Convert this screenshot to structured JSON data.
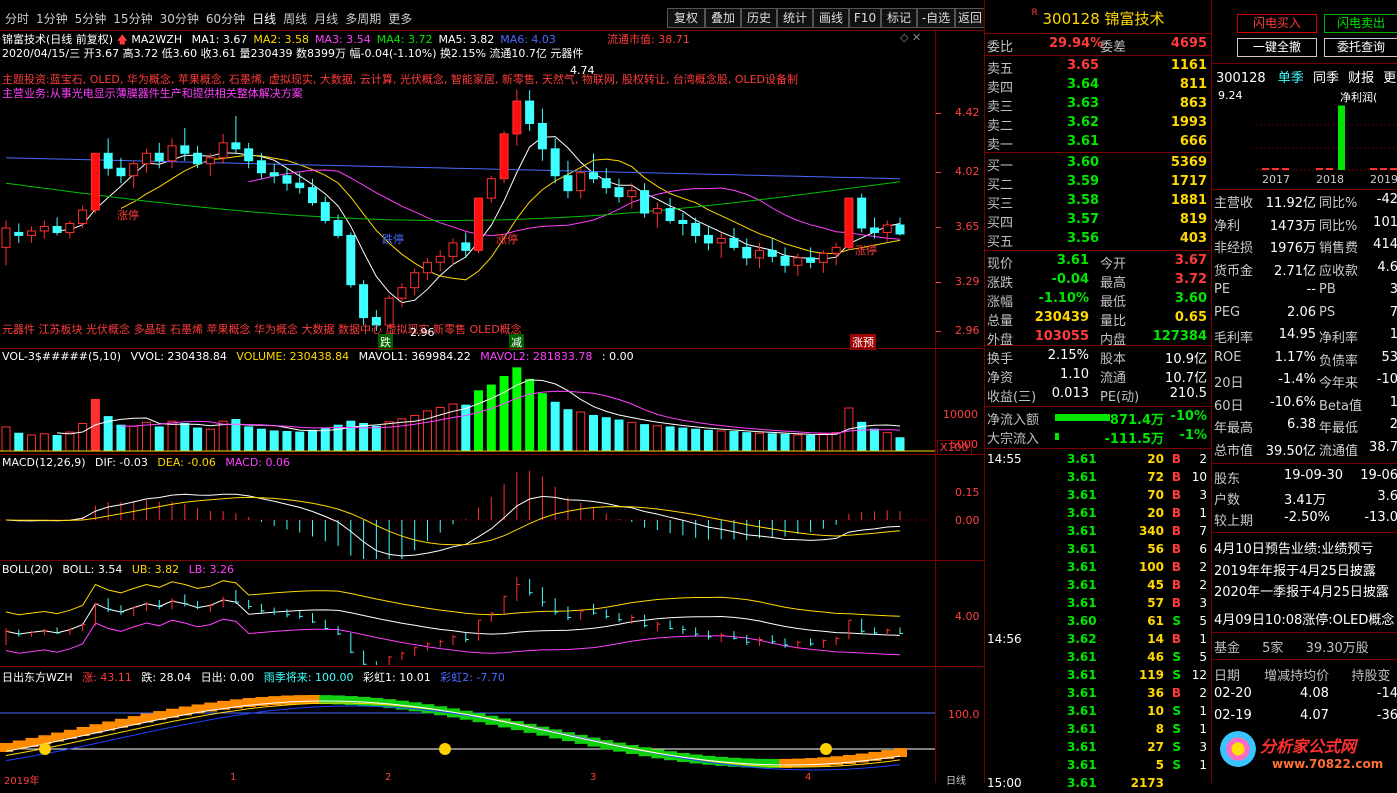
{
  "toolbar": {
    "left_tabs": [
      "分时",
      "1分钟",
      "5分钟",
      "15分钟",
      "30分钟",
      "60分钟",
      "日线",
      "周线",
      "月线",
      "多周期",
      "更多"
    ],
    "selected": "日线",
    "right_buttons": [
      "复权",
      "叠加",
      "历史",
      "统计",
      "画线",
      "F10",
      "标记",
      "-自选",
      "返回"
    ]
  },
  "stock": {
    "code": "300128",
    "name": "锦富技术",
    "marker": "R"
  },
  "chart_header": {
    "title": "锦富技术(日线 前复权)",
    "ma_label": "MA2WZH",
    "ma": [
      {
        "label": "MA1: 3.67",
        "color": "#ffffff"
      },
      {
        "label": "MA2: 3.58",
        "color": "#ffd800"
      },
      {
        "label": "MA3: 3.54",
        "color": "#ff40ff"
      },
      {
        "label": "MA4: 3.72",
        "color": "#00e600"
      },
      {
        "label": "MA5: 3.82",
        "color": "#ffffff"
      },
      {
        "label": "MA6: 4.03",
        "color": "#4a6aff"
      }
    ],
    "date_line": "2020/04/15/三 开3.67 高3.72 低3.60 收3.61 量230439 数8399万 幅-0.04(-1.10%) 换2.15% 流通10.7亿 元器件",
    "float_mv_label": "流通市值: 38.71",
    "concepts": "主题投资:蓝宝石, OLED, 华为概念, 苹果概念, 石墨烯, 虚拟现实, 大数据, 云计算, 光伏概念, 智能家居, 新零售, 天然气, 物联网, 股权转让, 台湾概念股, OLED设备制",
    "business": "主营业务:从事光电显示薄膜器件生产和提供相关整体解决方案",
    "bottom_tags": "元器件 江苏板块 光伏概念 多晶硅 石墨烯 苹果概念 华为概念 大数据 数据中心 虚拟现实 新零售 OLED概念",
    "low_label": "2.96",
    "high_label": "4.74",
    "signals": [
      "跌",
      "减",
      "涨预"
    ],
    "kline_labels": [
      "涨停",
      "跌停",
      "涨停",
      "涨停"
    ]
  },
  "price_axis": [
    "4.42",
    "4.02",
    "3.65",
    "3.29",
    "2.96"
  ],
  "vol_panel": {
    "title": "VOL-3$#####(5,10)",
    "vvol": "VVOL: 230438.84",
    "volume": "VOLUME: 230438.84",
    "mavol1": "MAVOL1: 369984.22",
    "mavol2": "MAVOL2: 281833.78",
    "extra": ": 0.00",
    "axis": [
      "10000",
      "5000"
    ],
    "unit": "X100"
  },
  "macd_panel": {
    "title": "MACD(12,26,9)",
    "dif": "DIF: -0.03",
    "dea": "DEA: -0.06",
    "macd": "MACD: 0.06",
    "axis": [
      "0.15",
      "0.00"
    ]
  },
  "boll_panel": {
    "title": "BOLL(20)",
    "boll": "BOLL: 3.54",
    "ub": "UB: 3.82",
    "lb": "LB: 3.26",
    "axis": [
      "4.00"
    ]
  },
  "sun_panel": {
    "title": "日出东方WZH",
    "zhang": "涨: 43.11",
    "die": "跌: 28.04",
    "richu": "日出: 0.00",
    "yuji": "雨季将来: 100.00",
    "caihong1": "彩虹1: 10.01",
    "caihong2": "彩虹2: -7.70",
    "axis": [
      "100.0"
    ]
  },
  "date_axis": [
    "2019年",
    "1",
    "2",
    "3",
    "4",
    "日线"
  ],
  "quote": {
    "weibi_label": "委比",
    "weibi": "29.94%",
    "weicha_label": "委差",
    "weicha": "4695",
    "sells": [
      {
        "label": "卖五",
        "price": "3.65",
        "vol": "1161",
        "pc": "red"
      },
      {
        "label": "卖四",
        "price": "3.64",
        "vol": "811",
        "pc": "green"
      },
      {
        "label": "卖三",
        "price": "3.63",
        "vol": "863",
        "pc": "green"
      },
      {
        "label": "卖二",
        "price": "3.62",
        "vol": "1993",
        "pc": "green"
      },
      {
        "label": "卖一",
        "price": "3.61",
        "vol": "666",
        "pc": "green"
      }
    ],
    "buys": [
      {
        "label": "买一",
        "price": "3.60",
        "vol": "5369",
        "pc": "green"
      },
      {
        "label": "买二",
        "price": "3.59",
        "vol": "1717",
        "pc": "green"
      },
      {
        "label": "买三",
        "price": "3.58",
        "vol": "1881",
        "pc": "green"
      },
      {
        "label": "买四",
        "price": "3.57",
        "vol": "819",
        "pc": "green"
      },
      {
        "label": "买五",
        "price": "3.56",
        "vol": "403",
        "pc": "green"
      }
    ],
    "stats": [
      {
        "l1": "现价",
        "v1": "3.61",
        "c1": "green",
        "l2": "今开",
        "v2": "3.67",
        "c2": "red"
      },
      {
        "l1": "涨跌",
        "v1": "-0.04",
        "c1": "green",
        "l2": "最高",
        "v2": "3.72",
        "c2": "red"
      },
      {
        "l1": "涨幅",
        "v1": "-1.10%",
        "c1": "green",
        "l2": "最低",
        "v2": "3.60",
        "c2": "green"
      },
      {
        "l1": "总量",
        "v1": "230439",
        "c1": "yellow",
        "l2": "量比",
        "v2": "0.65",
        "c2": "yellow"
      },
      {
        "l1": "外盘",
        "v1": "103055",
        "c1": "red",
        "l2": "内盘",
        "v2": "127384",
        "c2": "green"
      }
    ],
    "stats2": [
      {
        "l1": "换手",
        "v1": "2.15%",
        "l2": "股本",
        "v2": "10.9亿"
      },
      {
        "l1": "净资",
        "v1": "1.10",
        "l2": "流通",
        "v2": "10.7亿"
      },
      {
        "l1": "收益(三)",
        "v1": "0.013",
        "l2": "PE(动)",
        "v2": "210.5"
      }
    ],
    "flow": [
      {
        "label": "净流入额",
        "val": "-871.4万",
        "pct": "-10%"
      },
      {
        "label": "大宗流入",
        "val": "-111.5万",
        "pct": "-1%"
      }
    ]
  },
  "ticks": [
    {
      "time": "14:55",
      "price": "3.61",
      "vol": "20",
      "bs": "B",
      "n": "2"
    },
    {
      "time": "",
      "price": "3.61",
      "vol": "72",
      "bs": "B",
      "n": "10"
    },
    {
      "time": "",
      "price": "3.61",
      "vol": "70",
      "bs": "B",
      "n": "3"
    },
    {
      "time": "",
      "price": "3.61",
      "vol": "20",
      "bs": "B",
      "n": "1"
    },
    {
      "time": "",
      "price": "3.61",
      "vol": "340",
      "bs": "B",
      "n": "7"
    },
    {
      "time": "",
      "price": "3.61",
      "vol": "56",
      "bs": "B",
      "n": "6"
    },
    {
      "time": "",
      "price": "3.61",
      "vol": "100",
      "bs": "B",
      "n": "2"
    },
    {
      "time": "",
      "price": "3.61",
      "vol": "45",
      "bs": "B",
      "n": "2"
    },
    {
      "time": "",
      "price": "3.61",
      "vol": "57",
      "bs": "B",
      "n": "3"
    },
    {
      "time": "",
      "price": "3.60",
      "vol": "61",
      "bs": "S",
      "n": "5"
    },
    {
      "time": "14:56",
      "price": "3.62",
      "vol": "14",
      "bs": "B",
      "n": "1"
    },
    {
      "time": "",
      "price": "3.61",
      "vol": "46",
      "bs": "S",
      "n": "5"
    },
    {
      "time": "",
      "price": "3.61",
      "vol": "119",
      "bs": "S",
      "n": "12"
    },
    {
      "time": "",
      "price": "3.61",
      "vol": "36",
      "bs": "B",
      "n": "2"
    },
    {
      "time": "",
      "price": "3.61",
      "vol": "10",
      "bs": "S",
      "n": "1"
    },
    {
      "time": "",
      "price": "3.61",
      "vol": "8",
      "bs": "S",
      "n": "1"
    },
    {
      "time": "",
      "price": "3.61",
      "vol": "27",
      "bs": "S",
      "n": "3"
    },
    {
      "time": "",
      "price": "3.61",
      "vol": "5",
      "bs": "S",
      "n": "1"
    },
    {
      "time": "15:00",
      "price": "3.61",
      "vol": "2173",
      "bs": "",
      "n": ""
    }
  ],
  "f10": {
    "flash_buy": "闪电买入",
    "flash_sell": "闪电卖出",
    "cancel_all": "一键全撤",
    "cancel_query": "委托查询",
    "code": "300128",
    "tabs": [
      "单季",
      "同季",
      "财报",
      "更多"
    ],
    "chart_ytop": "9.24",
    "chart_label": "净利润(",
    "years": [
      "2017",
      "2018",
      "2019"
    ],
    "bars": [
      -0.05,
      8.6,
      0.0
    ],
    "rows": [
      {
        "l1": "主营收",
        "v1": "11.92亿",
        "l2": "同比%",
        "v2": "-42"
      },
      {
        "l1": "净利",
        "v1": "1473万",
        "l2": "同比%",
        "v2": "101"
      },
      {
        "l1": "非经损",
        "v1": "1976万",
        "l2": "销售费",
        "v2": "414"
      },
      {
        "l1": "货币金",
        "v1": "2.71亿",
        "l2": "应收款",
        "v2": "4.6"
      },
      {
        "l1": "PE",
        "v1": "--",
        "l2": "PB",
        "v2": "3"
      },
      {
        "l1": "PEG",
        "v1": "2.06",
        "l2": "PS",
        "v2": "7"
      },
      {
        "l1": "毛利率",
        "v1": "14.95",
        "l2": "净利率",
        "v2": "1"
      },
      {
        "l1": "ROE",
        "v1": "1.17%",
        "l2": "负债率",
        "v2": "53"
      },
      {
        "l1": "20日",
        "v1": "-1.4%",
        "l2": "今年来",
        "v2": "-10"
      },
      {
        "l1": "60日",
        "v1": "-10.6%",
        "l2": "Beta值",
        "v2": "1"
      },
      {
        "l1": "年最高",
        "v1": "6.38",
        "l2": "年最低",
        "v2": "2"
      },
      {
        "l1": "总市值",
        "v1": "39.50亿",
        "l2": "流通值",
        "v2": "38.7"
      }
    ],
    "holders": [
      {
        "l1": "股东",
        "v1": "19-09-30",
        "v2": "19-06"
      },
      {
        "l1": "户数",
        "v1": "3.41万",
        "v2": "3.6"
      },
      {
        "l1": "较上期",
        "v1": "-2.50%",
        "v2": "-13.0"
      }
    ],
    "news": [
      "4月10日预告业绩:业绩预亏",
      "2019年年报于4月25日披露",
      "2020年一季报于4月25日披露",
      "4月09日10:08涨停:OLED概念"
    ],
    "fund": {
      "label": "基金",
      "count": "5家",
      "amount": "39.30万股"
    },
    "fund_head": {
      "d": "日期",
      "a": "增减持均价",
      "b": "持股变"
    },
    "fund_rows": [
      {
        "d": "02-20",
        "a": "4.08",
        "b": "-14"
      },
      {
        "d": "02-19",
        "a": "4.07",
        "b": "-36"
      }
    ],
    "watermark": "分析家公式网",
    "watermark_url": "www.70822.com"
  },
  "chart_data": {
    "type": "candlestick",
    "ohlc": [
      [
        3.52,
        3.7,
        3.4,
        3.65
      ],
      [
        3.62,
        3.68,
        3.55,
        3.6
      ],
      [
        3.6,
        3.66,
        3.55,
        3.63
      ],
      [
        3.63,
        3.7,
        3.58,
        3.66
      ],
      [
        3.66,
        3.72,
        3.6,
        3.62
      ],
      [
        3.62,
        3.7,
        3.58,
        3.68
      ],
      [
        3.68,
        3.8,
        3.65,
        3.77
      ],
      [
        3.77,
        4.15,
        3.75,
        4.15
      ],
      [
        4.15,
        4.25,
        4.0,
        4.05
      ],
      [
        4.05,
        4.12,
        3.95,
        4.0
      ],
      [
        4.0,
        4.1,
        3.92,
        4.08
      ],
      [
        4.08,
        4.18,
        4.02,
        4.15
      ],
      [
        4.15,
        4.22,
        4.05,
        4.1
      ],
      [
        4.1,
        4.25,
        4.05,
        4.2
      ],
      [
        4.2,
        4.32,
        4.1,
        4.15
      ],
      [
        4.15,
        4.2,
        4.05,
        4.08
      ],
      [
        4.08,
        4.15,
        4.0,
        4.12
      ],
      [
        4.12,
        4.28,
        4.08,
        4.22
      ],
      [
        4.22,
        4.4,
        4.15,
        4.18
      ],
      [
        4.18,
        4.22,
        4.05,
        4.1
      ],
      [
        4.1,
        4.15,
        3.98,
        4.02
      ],
      [
        4.02,
        4.08,
        3.95,
        4.0
      ],
      [
        4.0,
        4.05,
        3.9,
        3.95
      ],
      [
        3.95,
        4.02,
        3.88,
        3.92
      ],
      [
        3.92,
        3.98,
        3.8,
        3.82
      ],
      [
        3.82,
        3.86,
        3.68,
        3.7
      ],
      [
        3.7,
        3.74,
        3.58,
        3.6
      ],
      [
        3.6,
        3.62,
        3.25,
        3.27
      ],
      [
        3.27,
        3.3,
        3.0,
        3.05
      ],
      [
        3.05,
        3.1,
        2.96,
        3.0
      ],
      [
        3.0,
        3.2,
        2.98,
        3.18
      ],
      [
        3.18,
        3.28,
        3.12,
        3.25
      ],
      [
        3.25,
        3.38,
        3.2,
        3.35
      ],
      [
        3.35,
        3.45,
        3.3,
        3.42
      ],
      [
        3.42,
        3.5,
        3.36,
        3.46
      ],
      [
        3.46,
        3.58,
        3.4,
        3.55
      ],
      [
        3.55,
        3.62,
        3.45,
        3.5
      ],
      [
        3.5,
        3.85,
        3.48,
        3.85
      ],
      [
        3.85,
        4.0,
        3.82,
        3.98
      ],
      [
        3.98,
        4.3,
        3.95,
        4.28
      ],
      [
        4.28,
        4.74,
        4.2,
        4.5
      ],
      [
        4.5,
        4.6,
        4.3,
        4.35
      ],
      [
        4.35,
        4.45,
        4.1,
        4.18
      ],
      [
        4.18,
        4.25,
        3.95,
        4.0
      ],
      [
        4.0,
        4.1,
        3.85,
        3.9
      ],
      [
        3.9,
        4.05,
        3.85,
        4.02
      ],
      [
        4.02,
        4.15,
        3.95,
        3.98
      ],
      [
        3.98,
        4.05,
        3.88,
        3.92
      ],
      [
        3.92,
        3.98,
        3.82,
        3.86
      ],
      [
        3.86,
        3.95,
        3.78,
        3.9
      ],
      [
        3.9,
        3.95,
        3.72,
        3.75
      ],
      [
        3.75,
        3.82,
        3.65,
        3.78
      ],
      [
        3.78,
        3.85,
        3.68,
        3.7
      ],
      [
        3.7,
        3.75,
        3.6,
        3.68
      ],
      [
        3.68,
        3.72,
        3.55,
        3.6
      ],
      [
        3.6,
        3.66,
        3.5,
        3.55
      ],
      [
        3.55,
        3.62,
        3.45,
        3.58
      ],
      [
        3.58,
        3.65,
        3.5,
        3.52
      ],
      [
        3.52,
        3.58,
        3.4,
        3.45
      ],
      [
        3.45,
        3.55,
        3.38,
        3.5
      ],
      [
        3.5,
        3.58,
        3.42,
        3.46
      ],
      [
        3.46,
        3.52,
        3.35,
        3.4
      ],
      [
        3.4,
        3.48,
        3.33,
        3.45
      ],
      [
        3.45,
        3.52,
        3.38,
        3.42
      ],
      [
        3.42,
        3.5,
        3.35,
        3.48
      ],
      [
        3.48,
        3.55,
        3.4,
        3.52
      ],
      [
        3.52,
        3.85,
        3.5,
        3.85
      ],
      [
        3.85,
        3.88,
        3.62,
        3.65
      ],
      [
        3.65,
        3.72,
        3.58,
        3.62
      ],
      [
        3.62,
        3.7,
        3.56,
        3.67
      ],
      [
        3.67,
        3.72,
        3.6,
        3.61
      ]
    ],
    "volume": [
      4200,
      3100,
      2800,
      3000,
      2700,
      3300,
      4800,
      9000,
      6000,
      4500,
      4300,
      5000,
      4200,
      5200,
      4800,
      4000,
      3800,
      5200,
      5500,
      4200,
      3800,
      3500,
      3400,
      3300,
      3600,
      4000,
      4500,
      5200,
      4800,
      4300,
      5100,
      5600,
      6200,
      7000,
      7600,
      8200,
      8000,
      10500,
      11500,
      13000,
      14500,
      12500,
      10000,
      8500,
      7200,
      6800,
      6200,
      5800,
      5400,
      5000,
      4600,
      4400,
      4200,
      4000,
      3800,
      3600,
      3500,
      3400,
      3200,
      3100,
      3000,
      2900,
      2800,
      2700,
      3000,
      3200,
      7500,
      5000,
      3800,
      3200,
      2304
    ]
  }
}
